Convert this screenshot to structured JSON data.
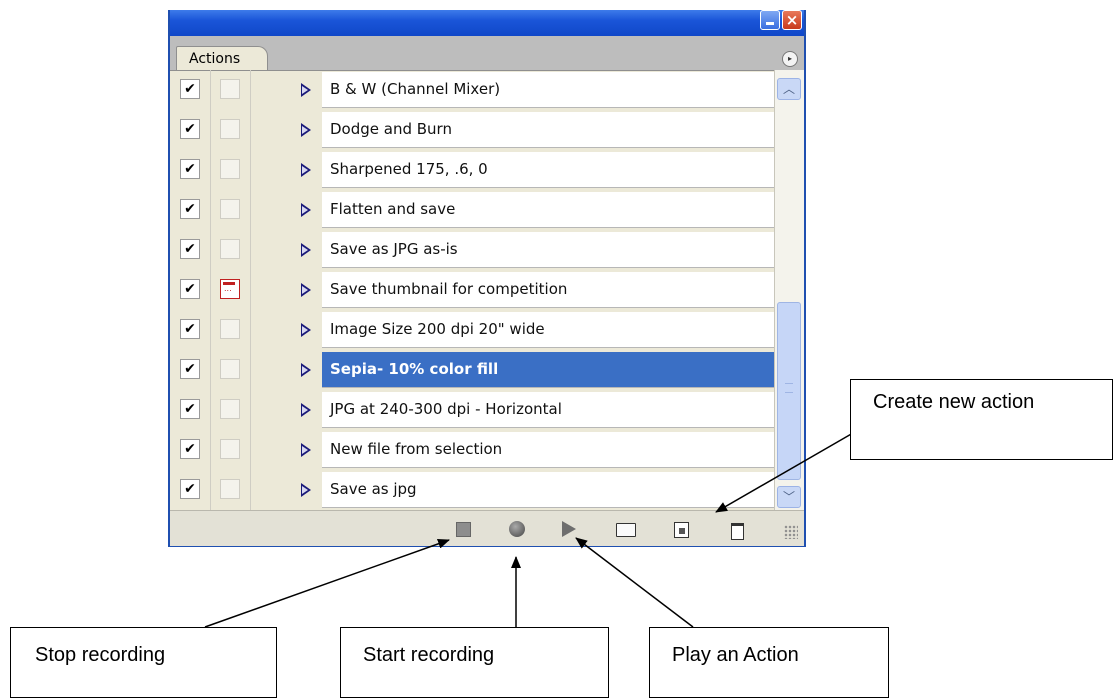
{
  "panel": {
    "tab_label": "Actions",
    "close_glyph": "×",
    "menu_glyph": "▸",
    "actions": [
      {
        "label": "B & W (Channel Mixer)",
        "checked": true,
        "dialog": false,
        "selected": false
      },
      {
        "label": "Dodge and Burn",
        "checked": true,
        "dialog": false,
        "selected": false
      },
      {
        "label": "Sharpened 175, .6, 0",
        "checked": true,
        "dialog": false,
        "selected": false
      },
      {
        "label": "Flatten and save",
        "checked": true,
        "dialog": false,
        "selected": false
      },
      {
        "label": "Save as JPG as-is",
        "checked": true,
        "dialog": false,
        "selected": false
      },
      {
        "label": "Save thumbnail for competition",
        "checked": true,
        "dialog": true,
        "selected": false
      },
      {
        "label": "Image Size 200 dpi 20\" wide",
        "checked": true,
        "dialog": false,
        "selected": false
      },
      {
        "label": "Sepia- 10% color fill",
        "checked": true,
        "dialog": false,
        "selected": true
      },
      {
        "label": "JPG at 240-300 dpi - Horizontal",
        "checked": true,
        "dialog": false,
        "selected": false
      },
      {
        "label": "New file from selection",
        "checked": true,
        "dialog": false,
        "selected": false
      },
      {
        "label": "Save as jpg",
        "checked": true,
        "dialog": false,
        "selected": false
      }
    ],
    "checkmark_glyph": "✔",
    "scroll_up_glyph": "︿",
    "scroll_down_glyph": "﹀",
    "toolbar_icons": [
      "stop-icon",
      "record-icon",
      "play-icon",
      "folder-icon",
      "new-action-icon",
      "trash-icon"
    ],
    "colors": {
      "titlebar": "#1a55d8",
      "selection": "#3a6fc5",
      "dialog_icon": "#c02020"
    }
  },
  "callouts": {
    "stop": "Stop recording",
    "start": "Start recording",
    "play": "Play an Action",
    "new": "Create new action"
  }
}
